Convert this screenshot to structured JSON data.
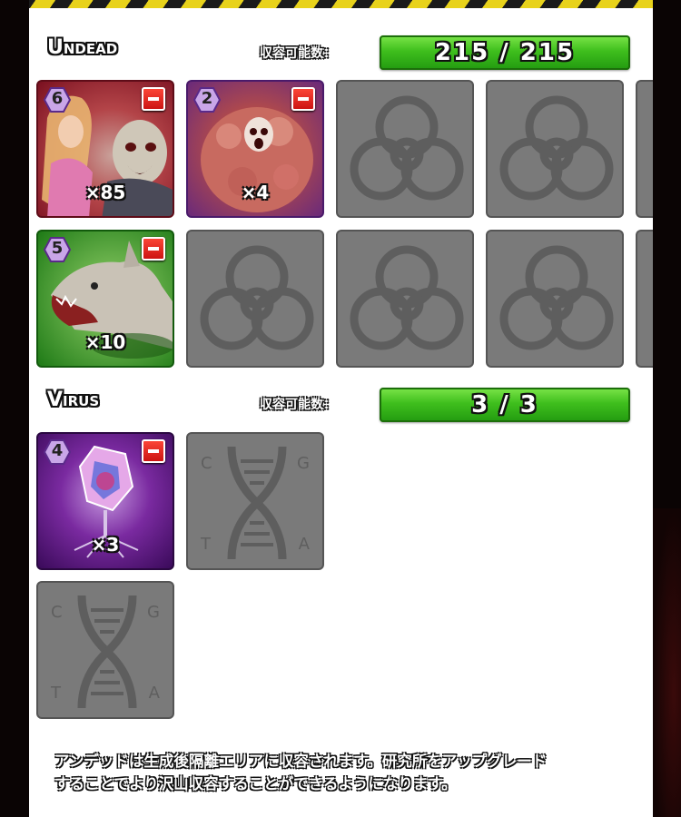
{
  "undead": {
    "title": "Undead",
    "capacity_label": "収容可能数：",
    "capacity_value": "215 / 215",
    "cards": [
      {
        "level": "6",
        "count": "×85",
        "theme": "zombie"
      },
      {
        "level": "2",
        "count": "×4",
        "theme": "flesh-blob"
      },
      {
        "level": "5",
        "count": "×10",
        "theme": "zombie-dog"
      }
    ]
  },
  "virus": {
    "title": "Virus",
    "capacity_label": "収容可能数：",
    "capacity_value": "3 / 3",
    "cards": [
      {
        "level": "4",
        "count": "×3",
        "theme": "virus-crystal"
      }
    ],
    "dna_letters": {
      "top_left": "C",
      "top_right": "G",
      "bottom_left": "T",
      "bottom_right": "A"
    }
  },
  "note": {
    "line1": "アンデッドは生成後隔離エリアに収容されます。研究所をアップグレード",
    "line2": "することでより沢山収容することができるようになります。"
  },
  "colors": {
    "capacity_bar": "#3fbf1d",
    "remove_button": "#e0201a",
    "empty_slot": "#7a7a7a",
    "hazard_yellow": "#e8d21a"
  },
  "icons": {
    "empty_undead_slot": "biohazard-icon",
    "empty_virus_slot": "dna-icon",
    "remove": "minus-icon",
    "level": "hexagon-level-icon"
  }
}
